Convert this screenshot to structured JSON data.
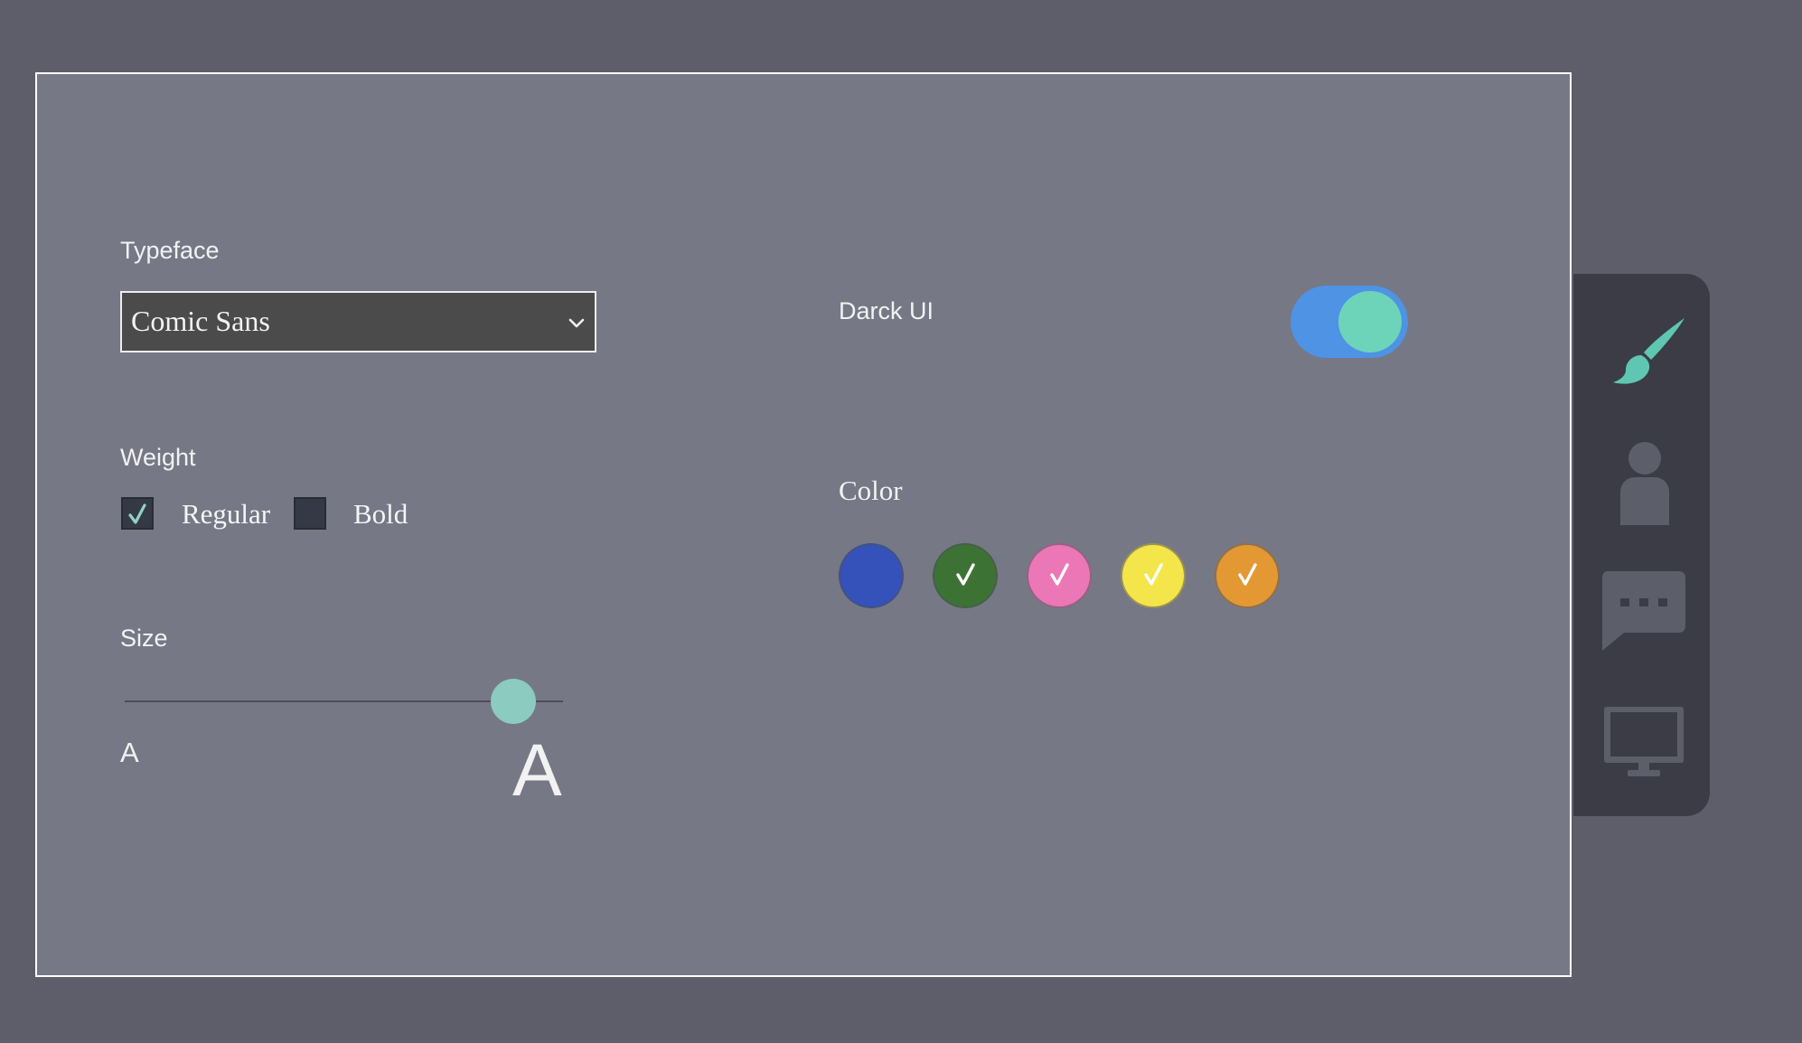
{
  "typeface": {
    "label": "Typeface",
    "selected": "Comic Sans"
  },
  "weight": {
    "label": "Weight",
    "options": [
      {
        "label": "Regular",
        "checked": true
      },
      {
        "label": "Bold",
        "checked": false
      }
    ]
  },
  "size": {
    "label": "Size",
    "min_label": "A",
    "max_label": "A",
    "value_fraction": 0.88
  },
  "dark_ui": {
    "label": "Darck UI",
    "on": true
  },
  "color": {
    "label": "Color",
    "swatches": [
      {
        "name": "blue",
        "hex": "#3452b9",
        "checked": false
      },
      {
        "name": "green",
        "hex": "#3d7235",
        "checked": true
      },
      {
        "name": "pink",
        "hex": "#ec77b6",
        "checked": true
      },
      {
        "name": "yellow",
        "hex": "#f4e54b",
        "checked": true
      },
      {
        "name": "orange",
        "hex": "#e39834",
        "checked": true
      }
    ]
  },
  "sidebar": {
    "items": [
      {
        "icon": "paintbrush-icon",
        "active": true
      },
      {
        "icon": "user-icon",
        "active": false
      },
      {
        "icon": "chat-bubble-icon",
        "active": false
      },
      {
        "icon": "monitor-icon",
        "active": false
      }
    ]
  },
  "theme": {
    "background": "#5e5e6b",
    "panel": "#767886",
    "accent_teal": "#6dd4b9",
    "toggle_blue": "#4e93e4",
    "rail": "#3b3c45",
    "inactive_icon": "#5c5f69"
  }
}
